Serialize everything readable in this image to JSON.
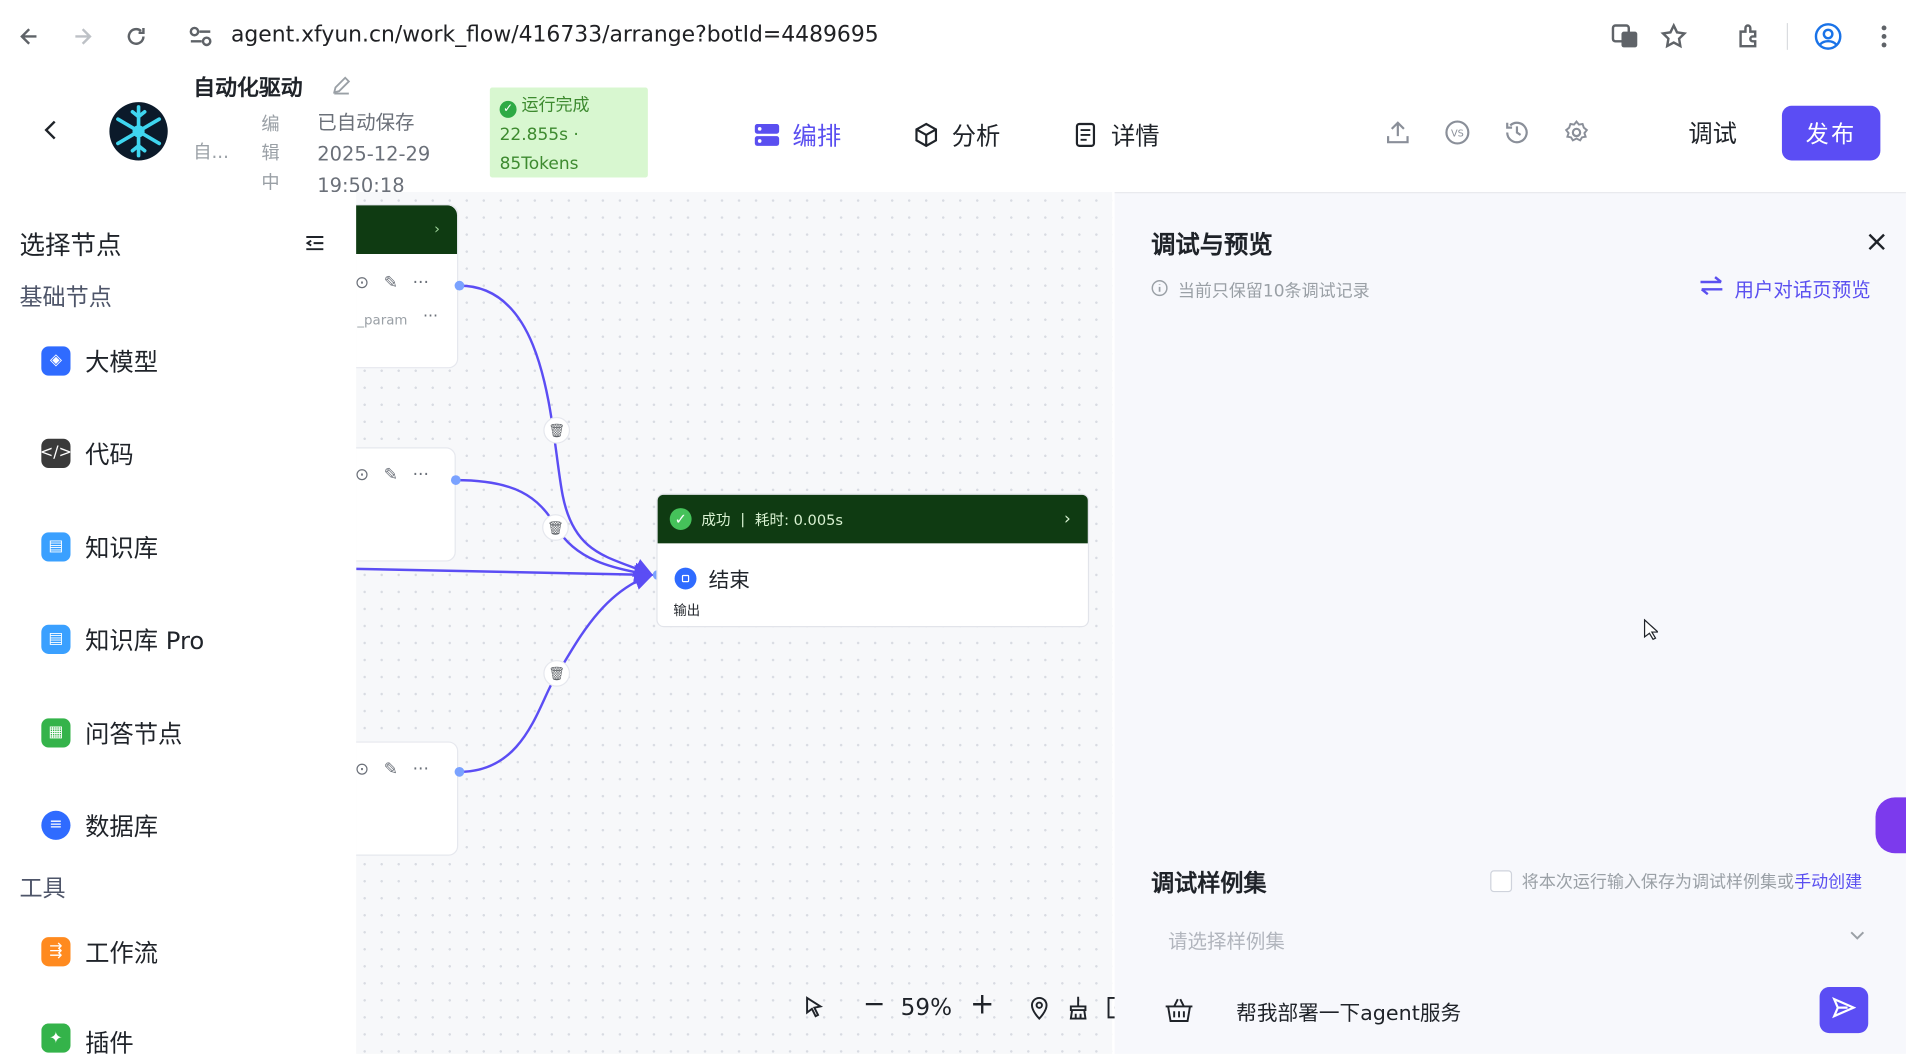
{
  "browser": {
    "url": "agent.xfyun.cn/work_flow/416733/arrange?botId=4489695"
  },
  "header": {
    "app_title": "自动化驱动",
    "app_sub": "自...",
    "edit_state": "编辑中",
    "saved_label": "已自动保存",
    "saved_date": "2025-12-29",
    "saved_time": "19:50:18",
    "run_status": "运行完成",
    "run_duration": "22.855s ·",
    "run_tokens": "85Tokens",
    "tabs": [
      {
        "label": "编排",
        "icon": "layers-icon",
        "active": true
      },
      {
        "label": "分析",
        "icon": "cube-icon",
        "active": false
      },
      {
        "label": "详情",
        "icon": "document-icon",
        "active": false
      }
    ],
    "debug_label": "调试",
    "publish_label": "发布",
    "accent_color": "#5b4df4"
  },
  "left_panel": {
    "title": "选择节点",
    "group_basic": "基础节点",
    "basic_nodes": [
      {
        "label": "大模型",
        "icon": "llm-icon",
        "color": "#2f6bff"
      },
      {
        "label": "代码",
        "icon": "code-icon",
        "color": "#3a3a3a"
      },
      {
        "label": "知识库",
        "icon": "knowledge-icon",
        "color": "#3aa0ff"
      },
      {
        "label": "知识库 Pro",
        "icon": "knowledge-pro-icon",
        "color": "#3aa0ff"
      },
      {
        "label": "问答节点",
        "icon": "qa-icon",
        "color": "#34b34a"
      },
      {
        "label": "数据库",
        "icon": "database-icon",
        "color": "#2f6bff"
      }
    ],
    "group_tools": "工具",
    "tool_nodes": [
      {
        "label": "工作流",
        "icon": "workflow-icon",
        "color": "#ff8a1f"
      },
      {
        "label": "插件",
        "icon": "plugin-icon",
        "color": "#34b34a"
      }
    ]
  },
  "canvas": {
    "node_param_text": "_param",
    "end_node": {
      "status": "成功",
      "divider": "|",
      "elapsed": "耗时: 0.005s",
      "title": "结束",
      "output_label": "输出",
      "status_color": "#0f3b12"
    },
    "zoom": "59%"
  },
  "right_panel": {
    "title": "调试与预览",
    "note": "当前只保留10条调试记录",
    "preview_link": "用户对话页预览",
    "sample_title": "调试样例集",
    "save_text": "将本次运行输入保存为调试样例集或",
    "save_link": "手动创建",
    "select_placeholder": "请选择样例集",
    "input_value": "帮我部署一下agent服务"
  }
}
